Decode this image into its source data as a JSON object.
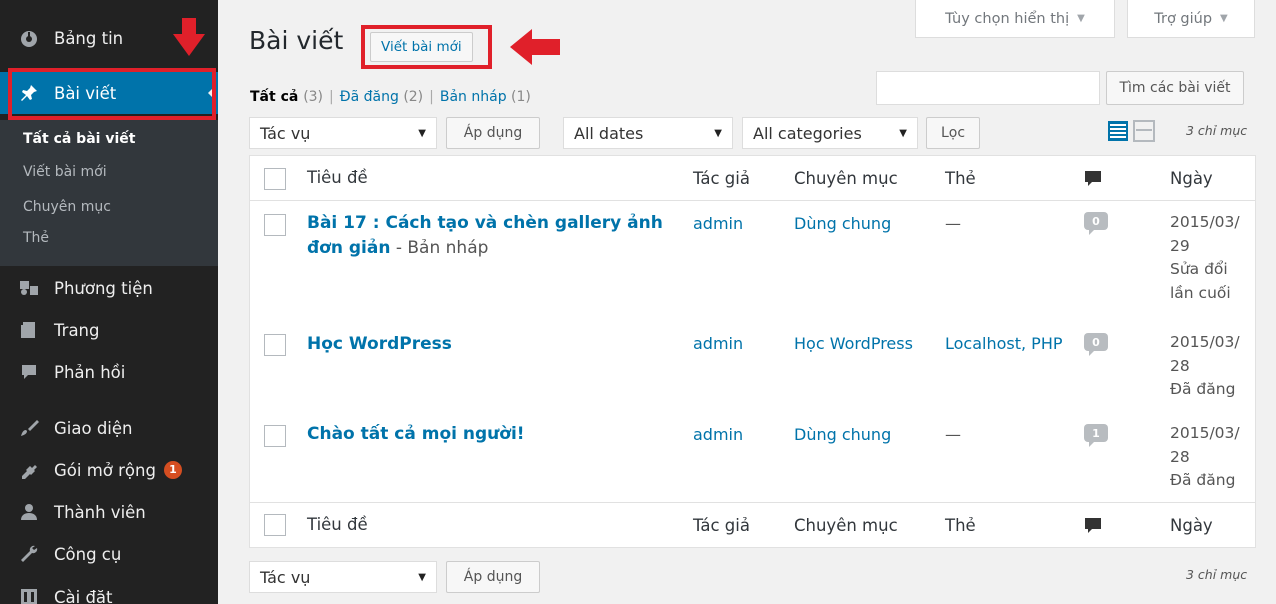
{
  "sidebar": {
    "menu": [
      {
        "label": "Bảng tin",
        "icon": "dashboard-icon"
      },
      {
        "label": "Bài viết",
        "icon": "pin-icon"
      },
      {
        "label": "Phương tiện",
        "icon": "media-icon"
      },
      {
        "label": "Trang",
        "icon": "page-icon"
      },
      {
        "label": "Phản hồi",
        "icon": "comment-icon"
      },
      {
        "label": "Giao diện",
        "icon": "brush-icon"
      },
      {
        "label": "Gói mở rộng",
        "icon": "plugin-icon",
        "badge": "1"
      },
      {
        "label": "Thành viên",
        "icon": "user-icon"
      },
      {
        "label": "Công cụ",
        "icon": "wrench-icon"
      },
      {
        "label": "Cài đặt",
        "icon": "settings-icon"
      }
    ],
    "submenu": [
      "Tất cả bài viết",
      "Viết bài mới",
      "Chuyên mục",
      "Thẻ"
    ]
  },
  "screen_options": {
    "label": "Tùy chọn hiển thị"
  },
  "help": {
    "label": "Trợ giúp"
  },
  "page": {
    "title": "Bài viết",
    "add_new": "Viết bài mới"
  },
  "filters": {
    "all": {
      "label": "Tất cả",
      "count": "(3)"
    },
    "published": {
      "label": "Đã đăng",
      "count": "(2)"
    },
    "draft": {
      "label": "Bản nháp",
      "count": "(1)"
    }
  },
  "search": {
    "button": "Tìm các bài viết",
    "value": ""
  },
  "bulk": {
    "label": "Tác vụ",
    "apply": "Áp dụng"
  },
  "dates": {
    "label": "All dates"
  },
  "categories": {
    "label": "All categories"
  },
  "filter_button": "Lọc",
  "items_count": "3 chỉ mục",
  "columns": {
    "title": "Tiêu đề",
    "author": "Tác giả",
    "category": "Chuyên mục",
    "tags": "Thẻ",
    "date": "Ngày"
  },
  "posts": [
    {
      "title_line1": "Bài 17 : Cách tạo và chèn gallery ảnh",
      "title_line2": "đơn giản",
      "state": " - Bản nháp",
      "author": "admin",
      "category": "Dùng chung",
      "tags": "—",
      "comments": "0",
      "date1": "2015/03/",
      "date2": "29",
      "date3": "Sửa đổi",
      "date4": "lần cuối"
    },
    {
      "title_line1": "Học WordPress",
      "author": "admin",
      "category": "Học WordPress",
      "tags": "Localhost, PHP",
      "comments": "0",
      "date1": "2015/03/",
      "date2": "28",
      "date3": "Đã đăng"
    },
    {
      "title_line1": "Chào tất cả mọi người!",
      "author": "admin",
      "category": "Dùng chung",
      "tags": "—",
      "comments": "1",
      "date1": "2015/03/",
      "date2": "28",
      "date3": "Đã đăng"
    }
  ],
  "colors": {
    "sidebar": "#222222",
    "submenu": "#32373c",
    "accent": "#0073aa",
    "annotation": "#e0202a",
    "badge": "#d54e21"
  }
}
